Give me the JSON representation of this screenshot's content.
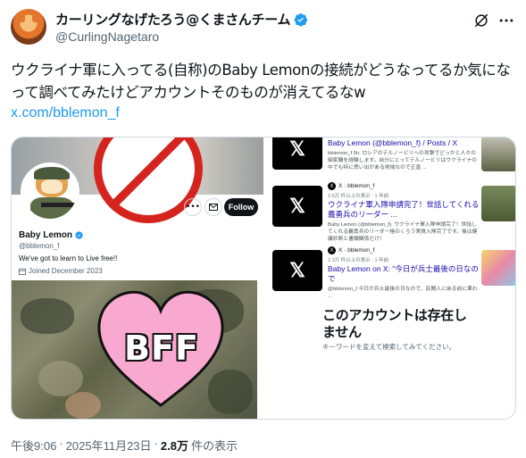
{
  "author": {
    "display_name": "カーリングなげたろう@くまさんチーム",
    "handle": "@CurlingNagetaro",
    "verified": true
  },
  "tweet": {
    "text": "ウクライナ軍に入ってる(自称)のBaby Lemonの接続がどうなってるか気になって調べてみたけどアカウントそのものが消えてるなw",
    "link": "x.com/bblemon_f"
  },
  "profile_card": {
    "name": "Baby Lemon",
    "handle": "@bblemon_f",
    "bio": "We've got to learn to Live free!!",
    "joined": "Joined December 2023",
    "follow_label": "Follow",
    "overlay_text": "BFF"
  },
  "search_results": [
    {
      "source": "",
      "meta": "",
      "title": "Baby Lemon (@bblemon_f) / Posts / X",
      "snippet": "bblemon_f 5h. ロシアのテルノービリへの攻撃でどっかと人々の御家騒を経験します。自分にとってテルノービリはウクライナの中でも特に思い出がある地域なので正直 ..."
    },
    {
      "source": "X · bblemon_f",
      "meta": "2.6万 件以上の表示 · 1 年前",
      "title": "ウクライナ軍入隊申請完了！世話してくれる義勇兵のリーダー ...",
      "snippet": "Baby Lemon (@bblemon_f). ウクライナ軍入隊申請完了！世話してくれる義勇兵のリーダー格のくろう実質入隊完了です。後は健康診断と書類関係だけ！"
    },
    {
      "source": "X · bblemon_f",
      "meta": "2.3万 件以上の表示 · 1 年前",
      "title": "Baby Lemon on X: \"今日が兵士最後の日なので",
      "snippet": "@bblemon_f 今日が兵士最後の日なので、民間人に戻る前に果わ ..."
    }
  ],
  "account_missing": {
    "title": "このアカウントは存在しません",
    "subtitle": "キーワードを変えて検索してみてください。"
  },
  "footer": {
    "time": "午後9:06",
    "separator": "·",
    "date": "2025年11月23日",
    "separator2": "·",
    "views": "2.8万",
    "views_label": "件の表示"
  },
  "colors": {
    "link": "#1d9bf0",
    "verified": "#1d9bf0",
    "muted": "#536471"
  },
  "icons": [
    "verified-icon",
    "grok-icon",
    "more-icon",
    "calendar-icon",
    "mail-icon",
    "x-logo-icon"
  ]
}
